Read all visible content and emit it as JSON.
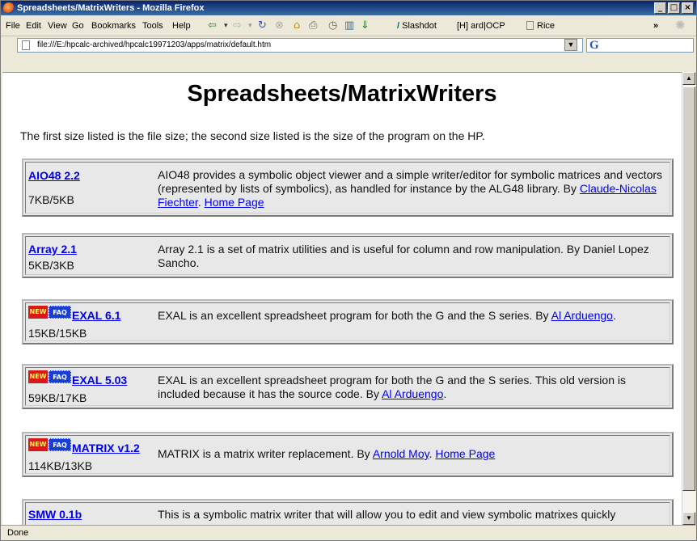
{
  "window": {
    "title": "Spreadsheets/MatrixWriters - Mozilla Firefox"
  },
  "menu": {
    "items": [
      "File",
      "Edit",
      "View",
      "Go",
      "Bookmarks",
      "Tools",
      "Help"
    ]
  },
  "bookmarks": {
    "slashdot": "Slashdot",
    "ardocp": "[H] ard|OCP",
    "rice": "Rice"
  },
  "address": {
    "url": "file:///E:/hpcalc-archived/hpcalc19971203/apps/matrix/default.htm"
  },
  "page": {
    "title": "Spreadsheets/MatrixWriters",
    "intro": "The first size listed is the file size; the second size listed is the size of the program on the HP.",
    "entries": [
      {
        "name": "AIO48 2.2",
        "size": "7KB/5KB",
        "badges": false,
        "desc": "AIO48 provides a symbolic object viewer and a simple writer/editor for symbolic matrices and vectors (represented by lists of symbolics), as handled for instance by the ALG48 library. By ",
        "link1": "Claude-Nicolas Fiechter",
        "sep": ". ",
        "link2": "Home Page",
        "tail": ""
      },
      {
        "name": "Array 2.1",
        "size": "5KB/3KB",
        "badges": false,
        "desc": "Array 2.1 is a set of matrix utilities and is useful for column and row manipulation. By Daniel Lopez Sancho.",
        "link1": "",
        "sep": "",
        "link2": "",
        "tail": ""
      },
      {
        "name": "EXAL 6.1",
        "size": "15KB/15KB",
        "badges": true,
        "desc": "EXAL is an excellent spreadsheet program for both the G and the S series. By ",
        "link1": "Al Arduengo",
        "sep": "",
        "link2": "",
        "tail": "."
      },
      {
        "name": "EXAL 5.03",
        "size": "59KB/17KB",
        "badges": true,
        "desc": "EXAL is an excellent spreadsheet program for both the G and the S series. This old version is included because it has the source code. By ",
        "link1": "Al Arduengo",
        "sep": "",
        "link2": "",
        "tail": "."
      },
      {
        "name": "MATRIX v1.2",
        "size": "114KB/13KB",
        "badges": true,
        "desc": "MATRIX is a matrix writer replacement. By ",
        "link1": "Arnold Moy",
        "sep": ". ",
        "link2": "Home Page",
        "tail": ""
      },
      {
        "name": "SMW 0.1b",
        "size": "",
        "badges": false,
        "desc": "This is a symbolic matrix writer that will allow you to edit and view symbolic matrixes quickly",
        "link1": "",
        "sep": "",
        "link2": "",
        "tail": ""
      }
    ],
    "badge_new": "NEW",
    "badge_faq": "FAQ"
  },
  "status": {
    "text": "Done"
  },
  "icons": [
    "firefox-icon",
    "back-icon",
    "forward-icon",
    "reload-icon",
    "stop-icon",
    "home-icon",
    "print-icon",
    "history-icon",
    "bookmarks-icon",
    "page-icon",
    "google-search-icon"
  ]
}
